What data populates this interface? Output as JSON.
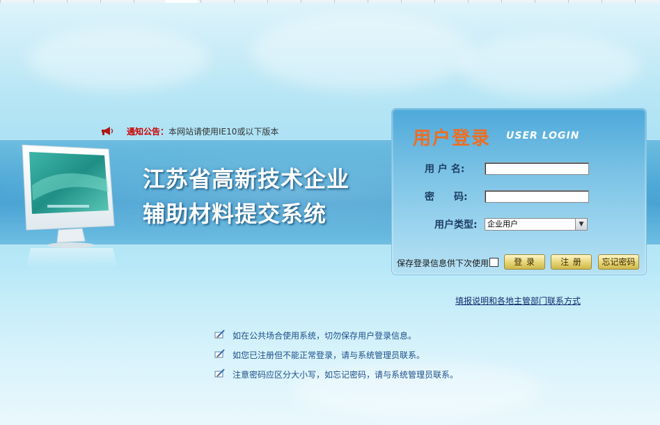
{
  "notice": {
    "label": "通知公告：",
    "text": "本网站请使用IE10或以下版本"
  },
  "banner": {
    "title_line1": "江苏省高新技术企业",
    "title_line2": "辅助材料提交系统"
  },
  "login": {
    "title": "用户登录",
    "subtitle": "USER LOGIN",
    "username_label": "用 户 名:",
    "username_value": "",
    "password_label": "密　　码:",
    "password_value": "",
    "user_type_label": "用户类型:",
    "user_type_selected": "企业用户",
    "remember_label": "保存登录信息供下次使用",
    "remember_checked": false,
    "buttons": {
      "login": "登 录",
      "register": "注 册",
      "forgot": "忘记密码"
    }
  },
  "contact_link": "填报说明和各地主管部门联系方式",
  "tips": [
    "如在公共场合使用系统，切勿保存用户登录信息。",
    "如您已注册但不能正常登录，请与系统管理员联系。",
    "注意密码应区分大小写，如忘记密码，请与系统管理员联系。"
  ],
  "colors": {
    "notice_label": "#cc0000",
    "login_title": "#f26c1e",
    "tip_text": "#1d4f8a",
    "link": "#102c6e"
  }
}
